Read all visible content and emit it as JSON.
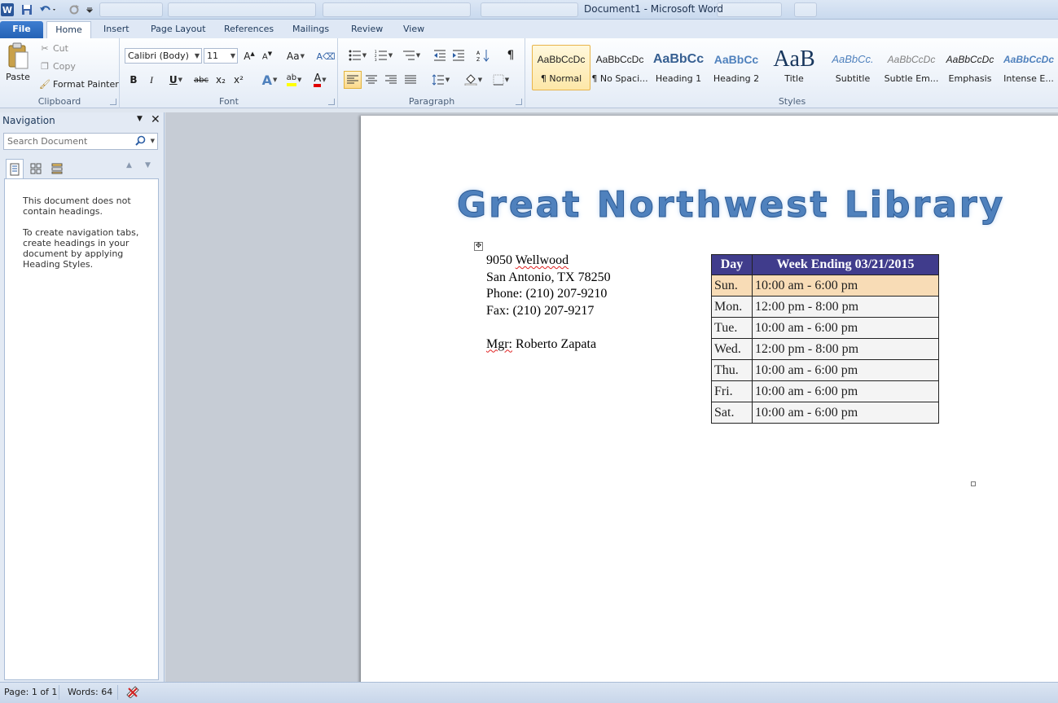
{
  "app": {
    "window_title": "Document1  -  Microsoft Word",
    "logo_letter": "W"
  },
  "tabs": [
    "File",
    "Home",
    "Insert",
    "Page Layout",
    "References",
    "Mailings",
    "Review",
    "View"
  ],
  "clipboard": {
    "paste": "Paste",
    "cut": "Cut",
    "copy": "Copy",
    "format_painter": "Format Painter",
    "label": "Clipboard"
  },
  "font": {
    "font_name": "Calibri (Body)",
    "font_size": "11",
    "change_case": "Aa",
    "label": "Font",
    "bold": "B",
    "italic": "I",
    "underline": "U",
    "strikethrough": "abc",
    "subscript": "x₂",
    "superscript": "x²"
  },
  "paragraph": {
    "label": "Paragraph",
    "pilcrow": "¶"
  },
  "styles": {
    "label": "Styles",
    "items": [
      {
        "sample": "AaBbCcDc",
        "name": "¶ Normal"
      },
      {
        "sample": "AaBbCcDc",
        "name": "¶ No Spaci..."
      },
      {
        "sample": "AaBbCc",
        "name": "Heading 1"
      },
      {
        "sample": "AaBbCc",
        "name": "Heading 2"
      },
      {
        "sample": "AaB",
        "name": "Title"
      },
      {
        "sample": "AaBbCc.",
        "name": "Subtitle"
      },
      {
        "sample": "AaBbCcDc",
        "name": "Subtle Em..."
      },
      {
        "sample": "AaBbCcDc",
        "name": "Emphasis"
      },
      {
        "sample": "AaBbCcDc",
        "name": "Intense E..."
      }
    ]
  },
  "navigation": {
    "title": "Navigation",
    "search_placeholder": "Search Document",
    "message1": "This document does not contain headings.",
    "message2": "To create navigation tabs, create headings in your document by applying Heading Styles."
  },
  "document": {
    "title": "Great Northwest Library",
    "address": {
      "street_num": "9050",
      "street_name": "Wellwood",
      "city_line": "San Antonio, TX 78250",
      "phone": "Phone: (210) 207-9210",
      "fax": "Fax: (210) 207-9217",
      "mgr_prefix": "Mgr:",
      "mgr_name": "Roberto Zapata"
    },
    "table": {
      "headers": [
        "Day",
        "Week Ending 03/21/2015"
      ],
      "rows": [
        [
          "Sun.",
          "10:00 am - 6:00 pm"
        ],
        [
          "Mon.",
          "12:00 pm - 8:00 pm"
        ],
        [
          "Tue.",
          "10:00 am - 6:00 pm"
        ],
        [
          "Wed.",
          "12:00 pm - 8:00 pm"
        ],
        [
          "Thu.",
          "10:00 am - 6:00 pm"
        ],
        [
          "Fri.",
          "10:00 am - 6:00 pm"
        ],
        [
          "Sat.",
          "10:00 am - 6:00 pm"
        ]
      ]
    }
  },
  "status": {
    "page": "Page: 1 of 1",
    "words": "Words: 64"
  },
  "colors": {
    "header_bg": "#403c8c",
    "highlight_row": "#f8dcb6",
    "title_blue": "#4f81bd"
  }
}
